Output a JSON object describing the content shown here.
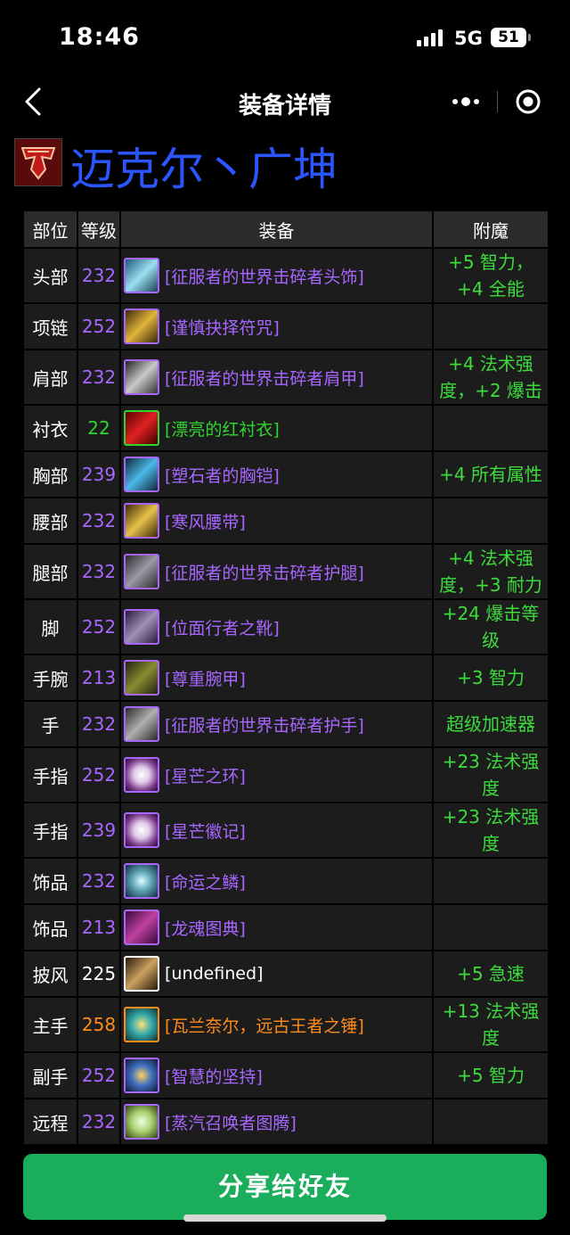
{
  "status_bar": {
    "time": "18:46",
    "network": "5G",
    "battery": "51"
  },
  "nav": {
    "title": "装备详情"
  },
  "profile": {
    "name": "迈克尔丶广坤"
  },
  "colors": {
    "epic": "#a866ff",
    "uncommon": "#2fd62f",
    "common": "#ffffff",
    "legendary": "#ff8c1a",
    "enchant": "#3ddc3d",
    "share_button": "#1aad5b",
    "name": "#2b55ff"
  },
  "table": {
    "headers": {
      "slot": "部位",
      "level": "等级",
      "item": "装备",
      "enchant": "附魔"
    },
    "rows": [
      {
        "slot": "头部",
        "level": "232",
        "item": "[征服者的世界击碎者头饰]",
        "enchant": "+5 智力，+4 全能",
        "quality": "epic",
        "icon": "helmet-icon"
      },
      {
        "slot": "项链",
        "level": "252",
        "item": "[谨慎抉择符咒]",
        "enchant": "",
        "quality": "epic",
        "icon": "amulet-icon"
      },
      {
        "slot": "肩部",
        "level": "232",
        "item": "[征服者的世界击碎者肩甲]",
        "enchant": "+4 法术强度，+2 爆击",
        "quality": "epic",
        "icon": "shoulder-icon"
      },
      {
        "slot": "衬衣",
        "level": "22",
        "item": "[漂亮的红衬衣]",
        "enchant": "",
        "quality": "uncommon",
        "icon": "shirt-icon"
      },
      {
        "slot": "胸部",
        "level": "239",
        "item": "[塑石者的胸铠]",
        "enchant": "+4 所有属性",
        "quality": "epic",
        "icon": "chest-icon"
      },
      {
        "slot": "腰部",
        "level": "232",
        "item": "[寒风腰带]",
        "enchant": "",
        "quality": "epic",
        "icon": "belt-icon"
      },
      {
        "slot": "腿部",
        "level": "232",
        "item": "[征服者的世界击碎者护腿]",
        "enchant": "+4 法术强度，+3 耐力",
        "quality": "epic",
        "icon": "legs-icon"
      },
      {
        "slot": "脚",
        "level": "252",
        "item": "[位面行者之靴]",
        "enchant": "+24 爆击等级",
        "quality": "epic",
        "icon": "boots-icon"
      },
      {
        "slot": "手腕",
        "level": "213",
        "item": "[尊重腕甲]",
        "enchant": "+3 智力",
        "quality": "epic",
        "icon": "bracer-icon"
      },
      {
        "slot": "手",
        "level": "232",
        "item": "[征服者的世界击碎者护手]",
        "enchant": "超级加速器",
        "quality": "epic",
        "icon": "gloves-icon"
      },
      {
        "slot": "手指",
        "level": "252",
        "item": "[星芒之环]",
        "enchant": "+23 法术强度",
        "quality": "epic",
        "icon": "ring-icon"
      },
      {
        "slot": "手指",
        "level": "239",
        "item": "[星芒徽记]",
        "enchant": "+23 法术强度",
        "quality": "epic",
        "icon": "ring-icon"
      },
      {
        "slot": "饰品",
        "level": "232",
        "item": "[命运之鳞]",
        "enchant": "",
        "quality": "epic",
        "icon": "trinket-scale-icon"
      },
      {
        "slot": "饰品",
        "level": "213",
        "item": "[龙魂图典]",
        "enchant": "",
        "quality": "epic",
        "icon": "book-icon"
      },
      {
        "slot": "披风",
        "level": "225",
        "item": "[undefined]",
        "enchant": "+5 急速",
        "quality": "common",
        "icon": "cloak-icon"
      },
      {
        "slot": "主手",
        "level": "258",
        "item": "[瓦兰奈尔，远古王者之锤]",
        "enchant": "+13 法术强度",
        "quality": "legendary",
        "icon": "mace-icon"
      },
      {
        "slot": "副手",
        "level": "252",
        "item": "[智慧的坚持]",
        "enchant": "+5 智力",
        "quality": "epic",
        "icon": "offhand-icon"
      },
      {
        "slot": "远程",
        "level": "232",
        "item": "[蒸汽召唤者图腾]",
        "enchant": "",
        "quality": "epic",
        "icon": "totem-icon"
      }
    ]
  },
  "share_button": {
    "label": "分享给好友"
  }
}
